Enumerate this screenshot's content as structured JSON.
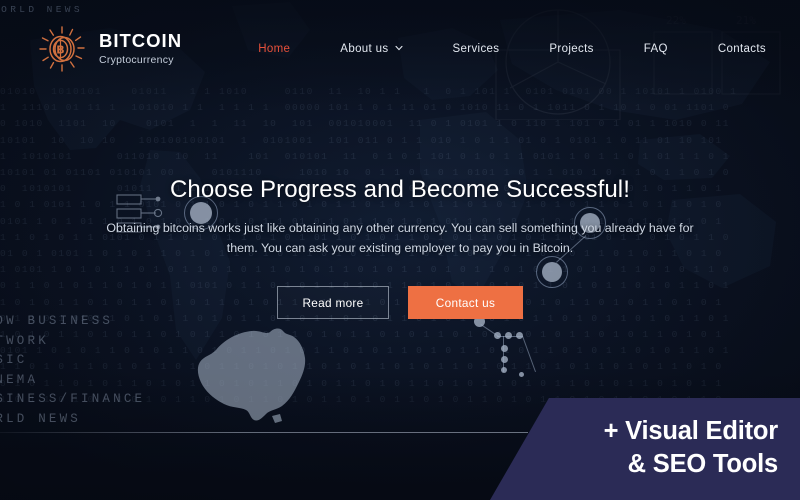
{
  "brand": {
    "logo_icon": "bitcoin-sun-coin-icon",
    "title": "BITCOIN",
    "subtitle": "Cryptocurrency"
  },
  "nav": {
    "items": [
      {
        "label": "Home",
        "active": true,
        "has_dropdown": false
      },
      {
        "label": "About us",
        "active": false,
        "has_dropdown": true
      },
      {
        "label": "Services",
        "active": false,
        "has_dropdown": false
      },
      {
        "label": "Projects",
        "active": false,
        "has_dropdown": false
      },
      {
        "label": "FAQ",
        "active": false,
        "has_dropdown": false
      },
      {
        "label": "Contacts",
        "active": false,
        "has_dropdown": false
      }
    ],
    "dropdown_icon": "chevron-down-icon"
  },
  "hero": {
    "title": "Choose Progress and Become Successful!",
    "paragraph": "Obtaining bitcoins works just like obtaining any other currency. You can sell something you already have for them. You can ask your existing employer to pay you in Bitcoin.",
    "buttons": {
      "secondary_label": "Read more",
      "primary_label": "Contact us"
    }
  },
  "promo": {
    "line1": "+ Visual Editor",
    "line2": "& SEO Tools"
  },
  "background": {
    "top_label": "WORLD NEWS",
    "category_lines": [
      "SHOW BUSINESS",
      "NETWORK",
      "MUSIC",
      "CINEMA",
      "BUSINESS/FINANCE",
      "WORLD NEWS"
    ],
    "binary_rows": [
      "01010  1010101    01011   1 1 1010     0110  11  10 1 1   1  0 1 101 1  0101 0101 00 1 10101 1 0100 1",
      "1  11101 01 11 1  101010 1 1  1 1 1 1  00000 101 1 0 1 11 01 0 1010 11 0 1 1011 0 1 10 1 0 01 1101 0",
      "0 1010  1101  10    0101  1  1  11  10  101  001010001  11 0 1 0101 1 0 110 1 101 0 1 01 1 1010 0 11",
      "10101  10  10 10   100100100101  1  0101001  101 011 0 1 1 010 1 0 1 1 01 0 1 0101 1 0 11 01 10 101",
      "1  1010101      011010  10  11    101  010101  11  0 1 0 1 101 0 1 0 1 1 0101 1 0 1 1 0 1 01 1 1 0 1",
      "10101 01 01101 010101 00     0101110     1010 10  0 1 1 0 1 0 1 0101 1 0 1 1 010 1 0 1 1 0 1 1 0 1 0",
      "0  1010101      01011   1 1 1010       0110 1 0 1 0 1 1 0 1 1 01 0 1 0 1 1 0 1 0101 1 0 1 0 1 1 0 1",
      "1 0 1 0101 1 0 1 1 0101 0 1 1 0 1 0 1 1 0 1 0 1 1 0 1 0 1 0 1 1 0 1 0 1 1 0 1 0 1 1 0 1 0 1 1 0 1 0",
      "0101 1 0 1 01 1 0 1 0 1 0 1 1 0 1 0 1 1 01 0 1 0 1 1 0 1 0 1 01 1 0 1 0 1 1 0 1 0 1 1 0 1 0 1 1 0 1",
      "1 1 0 1 0 1 1 0101 0 1 1 0 1 0 1 1 0 1 0 1 01 1 0 1 0 1 1 0 1 0 1 1 0 1 0 1 1 0101 0 1 1 0 1 0 1 1 0",
      "01 0 1 0101 1 0 1 0 1 1 0 1 0 1 1 0 1 0 1 1 0 1 0 1 1 0 1 0 1 1 0 1 0 1 1 0 1 0 1 1 0 1 0 1 1 0 1 0",
      "1 0101 1 0 1 0 1 1 0 1 0 1 1 0 1 0 1 1 0 1 0 1 1 0 1 0 1 1 0 1 0 1 1 0 1 0 1 1 0 1 0 1 1 0 1 0 1 1 0",
      "0 1 1 0 1 0 1 1 0 1 0 1 1 0101 0 1 1 0 1 0 1 1 0 1 0 1 1 0 1 0 1 1 0 1 0 1 1 0 1 0 1 1 0 1 0 1 1 0 1",
      "1 0 1 0 1 1 0 1 0 1 1 0 1 0 1 1 0 1 0 1 1 0 1 0 1 1 0 1 0 1 1 0 1 0 1 1 0 1 0 1 1 0 1 0 1 1 0 1 0 1",
      "0 1 1 0 1 0101 1 0 1 0 1 1 0 1 0 1 1 0 1 0 1 1 0 1 0 1 1 0 1 0 1 1 0 1 0 1 1 0 1 0 1 1 0 1 0 1 1 0 1",
      "1 0 1 0 1 1 0 1 0 1 1 0 1 0 1 1 0 1 0 1 1 0 1 0 1 1 0 1 0 1 1 0 1 0 1 1 0 1 0 1 1 0 1 0 1 1 0 1 0 1",
      "0101 1 0 1 0 1 1 0 1 0 1 1 0 1 0 1 1 0 1 0 1 1 0 1 0 1 1 0 1 0 1 1 0 1 0 1 1 0 1 0 1 1 0 1 0 1 1 0 1",
      "1 1 0 1 0 1 1 0 1 0 1 1 0 1 0 1 1 0 1 0 1 1 0 1 0 1 1 0 1 0 1 1 0 1 0 1 1 0 1 0 1 1 0 1 0 1 1 0 1 0",
      "0 1 0 1 1 0 1 0 1 1 0 1 0 1 1 0 1 0 1 1 0 1 0 1 1 0 1 0 1 1 0 1 0 1 1 0 1 0 1 1 0 1 0 1 1 0 1 0 1 1",
      "1 0 1 1 0 1 0 1 1 0 1 0 1 1 0 1 0 1 1 0 1 0 1 1 0 1 0 1 1 0 1 0 1 1 0 1 0 1 1 0 1 0 1 1 0 1 0 1 1 0"
    ],
    "australia_icon": "australia-continent-icon",
    "world_map_icon": "world-map-icon",
    "node_graph_icon": "network-node-graph-icon",
    "circuit_icon": "circuit-board-icon",
    "pie_chart_icon": "pie-chart-icon"
  },
  "colors": {
    "accent_orange": "#ee7043",
    "nav_active": "#e8503a",
    "promo_bg": "#2b2b56",
    "page_bg": "#0d1526",
    "text_primary": "#ffffff",
    "text_muted": "#cfd7e3"
  }
}
